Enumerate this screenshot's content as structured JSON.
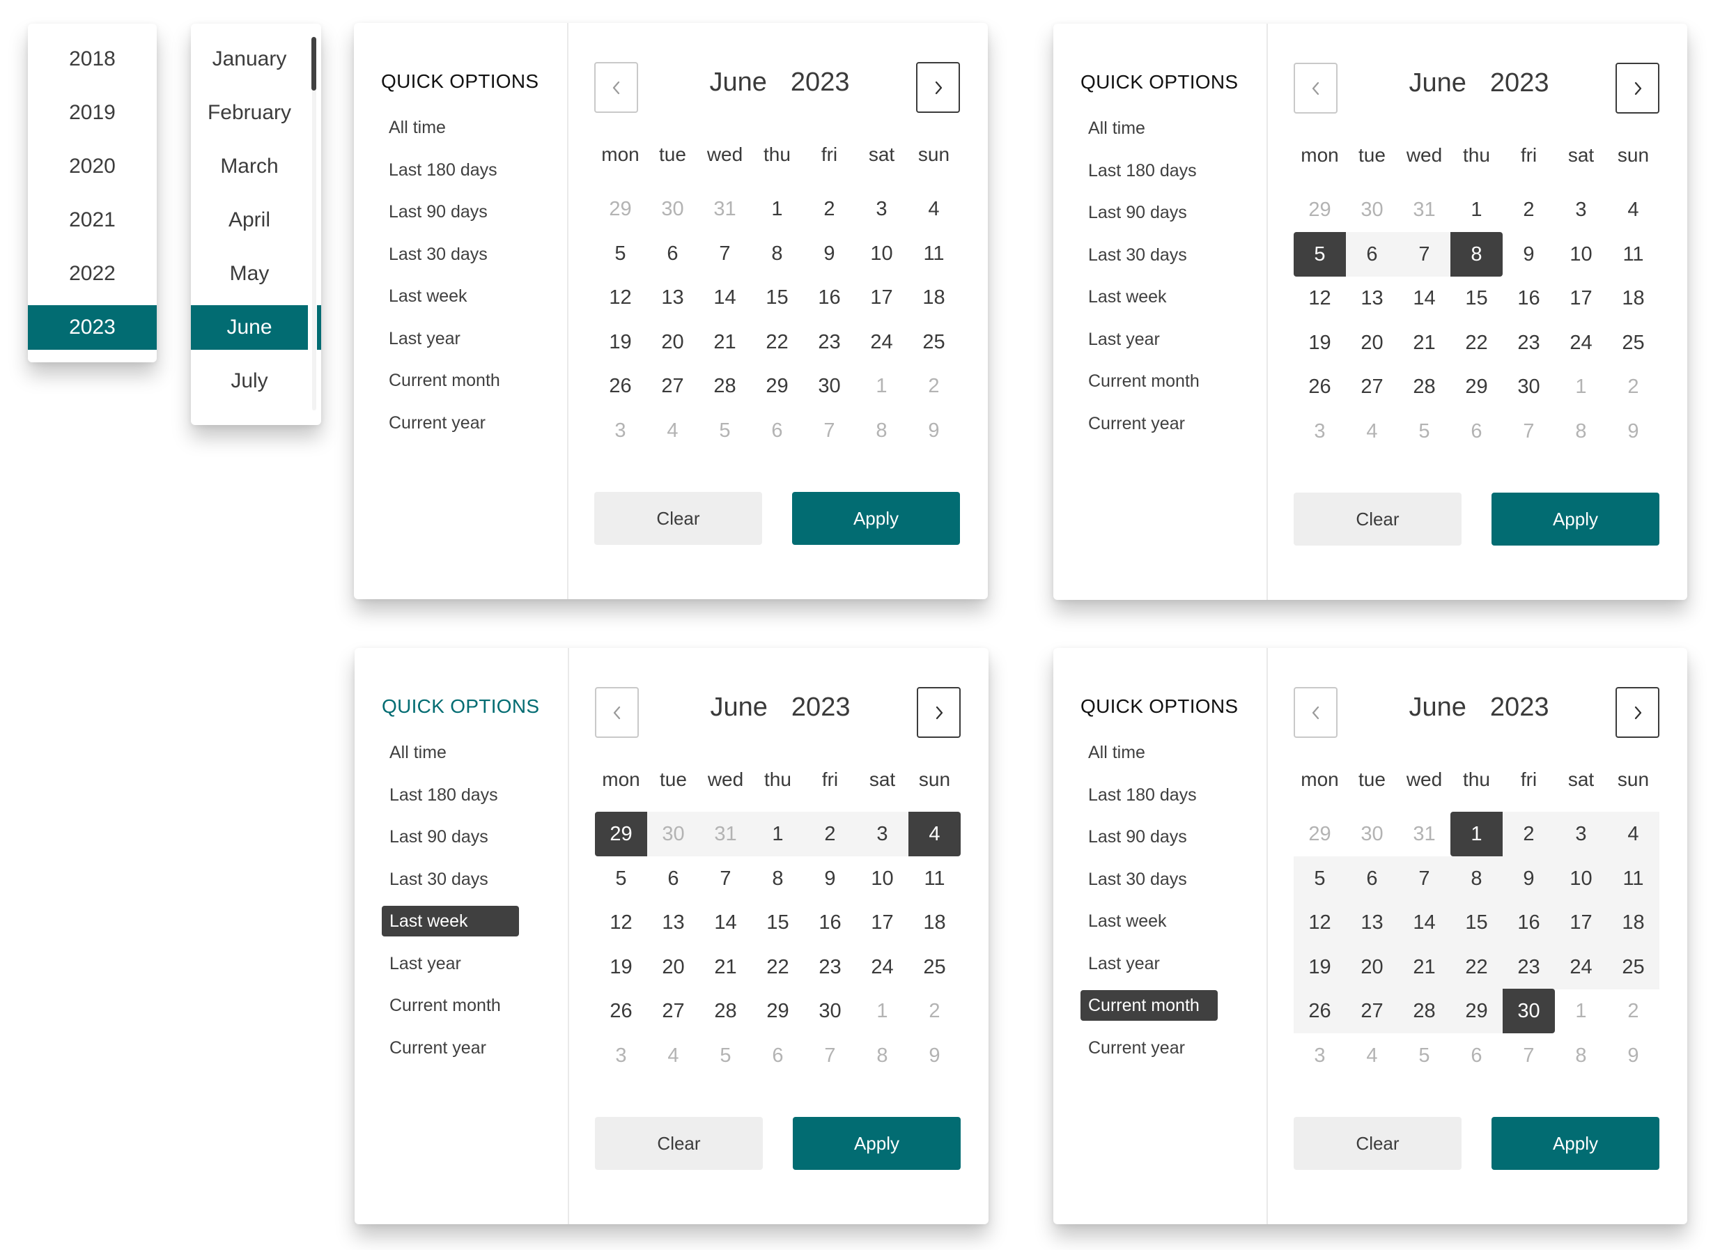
{
  "colors": {
    "accent": "#026c72",
    "selected_dark": "#404040",
    "range_fill": "#f4f4f4",
    "muted_text": "#b3b3b3"
  },
  "year_list": {
    "items": [
      "2018",
      "2019",
      "2020",
      "2021",
      "2022",
      "2023"
    ],
    "selected": "2023"
  },
  "month_list": {
    "items": [
      "January",
      "February",
      "March",
      "April",
      "May",
      "June",
      "July"
    ],
    "selected": "June",
    "scrollbar": "vertical"
  },
  "calendar_common": {
    "quick_options_title": "QUICK OPTIONS",
    "quick_options": [
      "All time",
      "Last 180 days",
      "Last 90 days",
      "Last 30 days",
      "Last week",
      "Last year",
      "Current month",
      "Current year"
    ],
    "month": "June",
    "year": "2023",
    "prev_icon": "chevron-left-icon",
    "next_icon": "chevron-right-icon",
    "weekdays": [
      "mon",
      "tue",
      "wed",
      "thu",
      "fri",
      "sat",
      "sun"
    ],
    "weeks": [
      [
        {
          "d": "29",
          "m": true
        },
        {
          "d": "30",
          "m": true
        },
        {
          "d": "31",
          "m": true
        },
        {
          "d": "1"
        },
        {
          "d": "2"
        },
        {
          "d": "3"
        },
        {
          "d": "4"
        }
      ],
      [
        {
          "d": "5"
        },
        {
          "d": "6"
        },
        {
          "d": "7"
        },
        {
          "d": "8"
        },
        {
          "d": "9"
        },
        {
          "d": "10"
        },
        {
          "d": "11"
        }
      ],
      [
        {
          "d": "12"
        },
        {
          "d": "13"
        },
        {
          "d": "14"
        },
        {
          "d": "15"
        },
        {
          "d": "16"
        },
        {
          "d": "17"
        },
        {
          "d": "18"
        }
      ],
      [
        {
          "d": "19"
        },
        {
          "d": "20"
        },
        {
          "d": "21"
        },
        {
          "d": "22"
        },
        {
          "d": "23"
        },
        {
          "d": "24"
        },
        {
          "d": "25"
        }
      ],
      [
        {
          "d": "26"
        },
        {
          "d": "27"
        },
        {
          "d": "28"
        },
        {
          "d": "29"
        },
        {
          "d": "30"
        },
        {
          "d": "1",
          "m": true
        },
        {
          "d": "2",
          "m": true
        }
      ],
      [
        {
          "d": "3",
          "m": true
        },
        {
          "d": "4",
          "m": true
        },
        {
          "d": "5",
          "m": true
        },
        {
          "d": "6",
          "m": true
        },
        {
          "d": "7",
          "m": true
        },
        {
          "d": "8",
          "m": true
        },
        {
          "d": "9",
          "m": true
        }
      ]
    ],
    "clear_label": "Clear",
    "apply_label": "Apply"
  },
  "panels": [
    {
      "id": "default",
      "title_highlighted": false,
      "selected_option": null,
      "range_start": null,
      "range_end": null
    },
    {
      "id": "custom-range",
      "title_highlighted": false,
      "selected_option": null,
      "range_start": [
        1,
        0
      ],
      "range_end": [
        1,
        3
      ]
    },
    {
      "id": "last-week",
      "title_highlighted": true,
      "selected_option": "Last week",
      "range_start": [
        0,
        0
      ],
      "range_end": [
        0,
        6
      ]
    },
    {
      "id": "current-month",
      "title_highlighted": false,
      "selected_option": "Current month",
      "range_start": [
        0,
        3
      ],
      "range_end": [
        4,
        4
      ]
    }
  ]
}
